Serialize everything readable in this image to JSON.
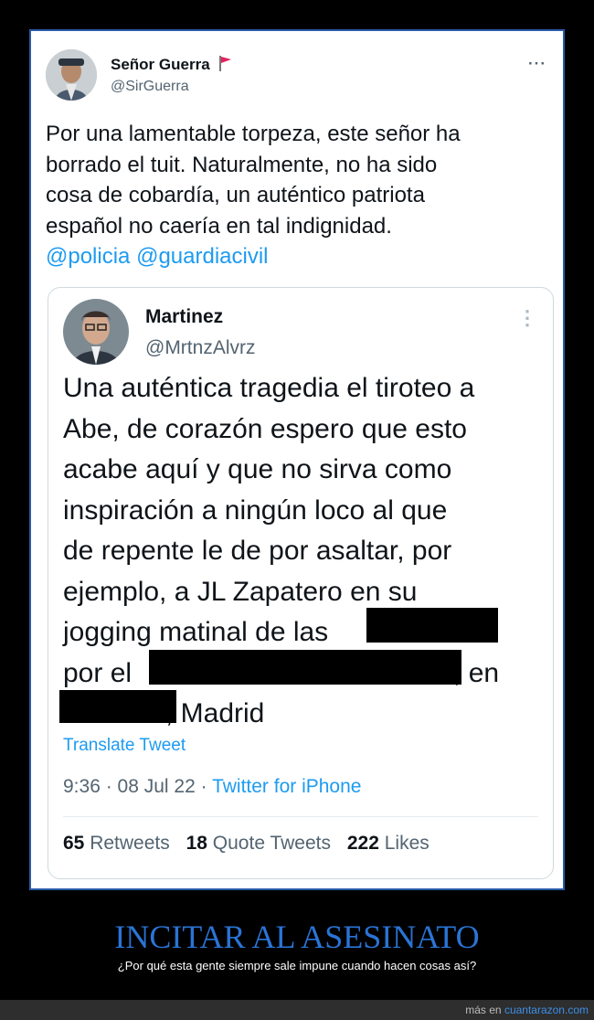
{
  "tweet": {
    "author_name": "Señor Guerra",
    "author_handle": "@SirGuerra",
    "more_label": "···",
    "text_lines": [
      "Por una lamentable torpeza, este señor ha",
      "borrado el tuit. Naturalmente, no ha sido",
      "cosa de cobardía, un auténtico patriota",
      "español no caería en tal indignidad."
    ],
    "mention_1": "@policia",
    "mention_2": "@guardiacivil"
  },
  "quoted": {
    "author_name": "Martinez",
    "author_handle": "@MrtnzAlvrz",
    "more_label": "⋮",
    "lines": {
      "l1": "Una auténtica tragedia el tiroteo a",
      "l2": "Abe, de corazón espero que esto",
      "l3": "acabe aquí y que no sirva como",
      "l4": "inspiración a ningún loco al que",
      "l5": "de repente le de por asaltar, por",
      "l6": "ejemplo, a JL Zapatero en su",
      "l7": "jogging matinal de las",
      "l8a": "por el",
      "l8b": ", en",
      "l9": ", Madrid"
    },
    "translate": "Translate Tweet",
    "timestamp": "9:36 · 08 Jul 22 · ",
    "source": "Twitter for iPhone",
    "retweets_count": "65",
    "retweets_label": "Retweets",
    "quotes_count": "18",
    "quotes_label": "Quote Tweets",
    "likes_count": "222",
    "likes_label": "Likes"
  },
  "caption": {
    "title": "INCITAR AL ASESINATO",
    "subtitle": "¿Por qué esta gente siempre sale impune cuando hacen cosas así?"
  },
  "footer": {
    "prefix": "más en ",
    "site": "cuantarazon.com"
  },
  "colors": {
    "accent": "#1d9bf0",
    "caption_title": "#2a74d6",
    "frame_border": "#2b5aa8"
  },
  "icons": [
    "red-flag-icon",
    "more-options-icon",
    "avatar-image"
  ]
}
